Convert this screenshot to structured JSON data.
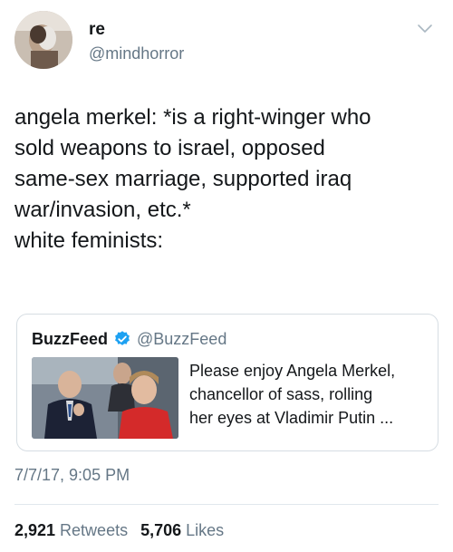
{
  "author": {
    "display_name": "re",
    "handle": "@mindhorror"
  },
  "menu": {
    "icon": "chevron-down-icon"
  },
  "tweet": {
    "lines": [
      "angela merkel: *is a right-winger who",
      "sold weapons to israel, opposed",
      "same-sex marriage, supported iraq",
      "war/invasion, etc.*",
      "white feminists:"
    ]
  },
  "quoted_tweet": {
    "name": "BuzzFeed",
    "handle": "@BuzzFeed",
    "verified_icon": "verified-badge-icon",
    "verified_color": "#1da1f2",
    "lines": [
      "Please enjoy Angela Merkel,",
      "chancellor of sass, rolling",
      "her eyes at Vladimir Putin ..."
    ]
  },
  "timestamp": "7/7/17, 9:05 PM",
  "stats": {
    "retweets_count": "2,921",
    "retweets_label": "Retweets",
    "likes_count": "5,706",
    "likes_label": "Likes"
  },
  "colors": {
    "text": "#14171a",
    "secondary": "#657786",
    "border": "#e1e8ed"
  }
}
